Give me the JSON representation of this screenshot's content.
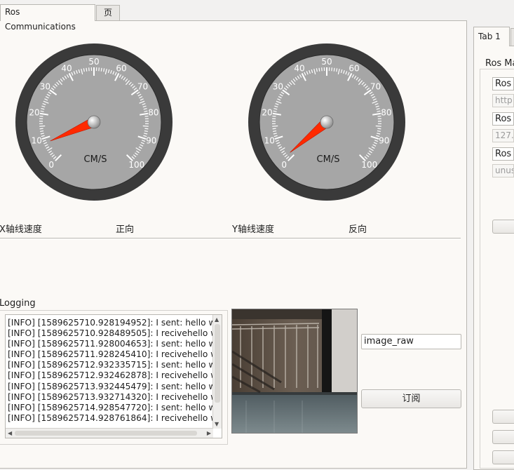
{
  "tabs": {
    "main": "Ros Communications",
    "second": "页"
  },
  "right_panel": {
    "tab_label": "Tab 1",
    "group_title": "Ros Ma",
    "rows": [
      {
        "label": "Ros",
        "value": "http:"
      },
      {
        "label": "Ros",
        "value": "127.0"
      },
      {
        "label": "Ros",
        "value": "unus"
      }
    ]
  },
  "gauges": [
    {
      "unit": "CM/S",
      "ticks": [
        "0",
        "10",
        "20",
        "30",
        "40",
        "50",
        "60",
        "70",
        "80",
        "90",
        "100"
      ],
      "value": 8
    },
    {
      "unit": "CM/S",
      "ticks": [
        "0",
        "10",
        "20",
        "30",
        "40",
        "50",
        "60",
        "70",
        "80",
        "90",
        "100"
      ],
      "value": 2
    }
  ],
  "labels": {
    "x_speed": "X轴线速度",
    "x_dir": "正向",
    "y_speed": "Y轴线速度",
    "y_dir": "反向",
    "logging": "Logging"
  },
  "log_lines": [
    "[INFO] [1589625710.928194952]: I sent: hello w",
    "[INFO] [1589625710.928489505]: I recivehello w",
    "[INFO] [1589625711.928004653]: I sent: hello w",
    "[INFO] [1589625711.928245410]: I recivehello w",
    "[INFO] [1589625712.932335715]: I sent: hello w",
    "[INFO] [1589625712.932462878]: I recivehello w",
    "[INFO] [1589625713.932445479]: I sent: hello w",
    "[INFO] [1589625713.932714320]: I recivehello w",
    "[INFO] [1589625714.928547720]: I sent: hello w",
    "[INFO] [1589625714.928761864]: I recivehello w"
  ],
  "topic_input": {
    "value": "image_raw"
  },
  "subscribe_button": "订阅",
  "colors": {
    "needle": "#ff2a00",
    "gauge_face": "#a6a6a6",
    "gauge_bezel": "#3a3a3a"
  }
}
